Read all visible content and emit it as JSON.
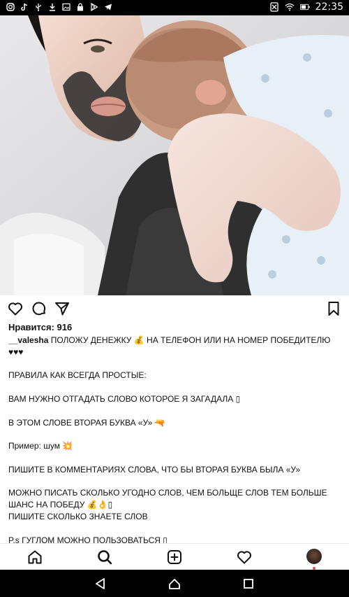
{
  "status_bar": {
    "time": "22:35",
    "left_icons": [
      "instagram-icon",
      "tiktok-icon",
      "usb-icon",
      "download-icon",
      "image-icon",
      "lock-icon",
      "play-store-icon",
      "telegram-icon"
    ],
    "right_icons": [
      "mute-icon",
      "wifi-icon",
      "battery-icon"
    ]
  },
  "post": {
    "likes_text": "Нравится: 916",
    "username": "__valesha",
    "caption_first": " ПОЛОЖУ ДЕНЕЖКУ 💰 НА ТЕЛЕФОН ИЛИ НА НОМЕР ПОБЕДИТЕЛЮ ♥♥♥",
    "lines": {
      "l2": "ПРАВИЛА КАК ВСЕГДА ПРОСТЫЕ:",
      "l3": "ВАМ НУЖНО ОТГАДАТЬ СЛОВО КОТОРОЕ Я ЗАГАДАЛА ▯",
      "l4": "В ЭТОМ СЛОВЕ ВТОРАЯ БУКВА «У» 🔫",
      "l5": "Пример: шум 💥",
      "l6": "ПИШИТЕ В КОММЕНТАРИЯХ СЛОВА, ЧТО БЫ ВТОРАЯ БУКВА БЫЛА «У»",
      "l7": "МОЖНО ПИСАТЬ СКОЛЬКО УГОДНО СЛОВ, ЧЕМ БОЛЬЩЕ СЛОВ ТЕМ БОЛЬШЕ ШАНС НА ПОБЕДУ 💰👌▯",
      "l8": "ПИШИТЕ СКОЛЬКО ЗНАЕТЕ СЛОВ",
      "l9": "P.s ГУГЛОМ МОЖНО ПОЛЬЗОВАТЬСЯ ▯"
    }
  },
  "actions": [
    "heart-icon",
    "comment-icon",
    "share-icon",
    "bookmark-icon"
  ],
  "bottom_nav": [
    "home-icon",
    "search-icon",
    "add-post-icon",
    "activity-heart-icon",
    "profile-avatar"
  ],
  "system_nav": [
    "back-icon",
    "home-circle-icon",
    "recents-icon"
  ],
  "colors": {
    "accent_notification": "#ed4956",
    "text": "#111111",
    "bar": "#000000"
  }
}
